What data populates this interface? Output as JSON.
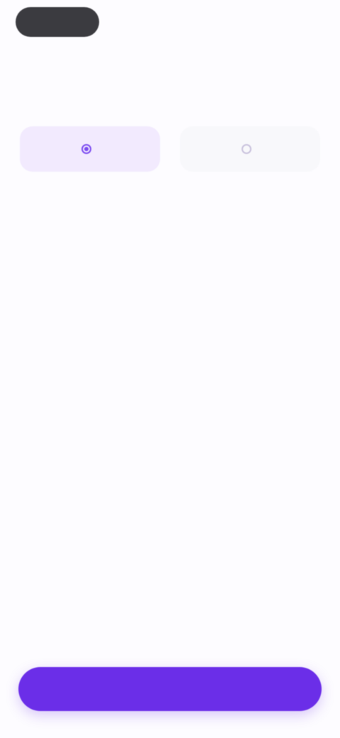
{
  "top_bar": {
    "action_label": ""
  },
  "title": "",
  "step": {
    "label": "",
    "badge": ""
  },
  "question": "",
  "hint": "",
  "options": [
    {
      "label": "",
      "selected": true
    },
    {
      "label": "",
      "selected": false
    }
  ],
  "primary_button": {
    "label": ""
  },
  "colors": {
    "accent": "#6b2ee8",
    "accent_light": "#f2eafe",
    "status_pill": "#3b3b40",
    "background": "#fdfcff"
  }
}
